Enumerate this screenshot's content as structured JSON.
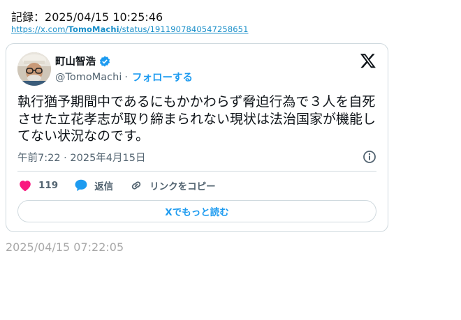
{
  "record": {
    "label": "記録：",
    "datetime": "2025/04/15 10:25:46"
  },
  "url": {
    "prefix": "https://x.com/",
    "user": "TomoMachi",
    "suffix": "/status/1911907840547258651"
  },
  "tweet": {
    "display_name": "町山智浩",
    "handle": "@TomoMachi",
    "separator": "·",
    "follow_label": "フォローする",
    "text": "執行猶予期間中であるにもかかわらず脅迫行為で３人を自死させた立花孝志が取り締まられない現状は法治国家が機能してない状況なのです。",
    "time": "午前7:22",
    "date_separator": "·",
    "date": "2025年4月15日",
    "likes": "119",
    "reply_label": "返信",
    "copy_link_label": "リンクをコピー",
    "read_more_label": "Xでもっと読む"
  },
  "footer_timestamp": "2025/04/15 07:22:05",
  "colors": {
    "accent": "#1d9bf0",
    "like": "#f91880",
    "muted": "#536471",
    "border": "#cfd9de"
  }
}
